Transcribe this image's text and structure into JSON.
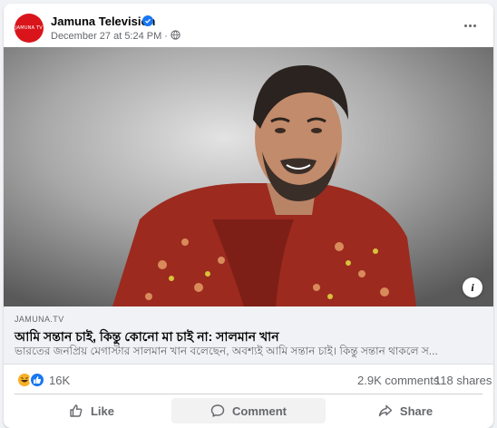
{
  "post": {
    "page_name": "Jamuna Television",
    "avatar_text": "JAMUNA TV",
    "timestamp": "December 27 at 5:24 PM",
    "separator": "·",
    "privacy_icon": "globe-icon",
    "more_icon": "more-options-icon",
    "verified_icon": "verified-badge-icon"
  },
  "link": {
    "domain": "JAMUNA.TV",
    "headline": "আমি সন্তান চাই, কিন্তু কোনো মা চাই না: সালমান খান",
    "description": "ভারতের জনপ্রিয় মেগাস্টার সালমান খান বলেছেন, অবশ্যই আমি সন্তান চাই। কিন্তু সন্তান থাকলে স..."
  },
  "stats": {
    "reactions": "16K",
    "comments": "2.9K comments",
    "shares": "118 shares",
    "reaction_icons": [
      "haha-icon",
      "like-icon"
    ]
  },
  "actions": {
    "like": "Like",
    "comment": "Comment",
    "share": "Share"
  },
  "colors": {
    "brand_blue": "#1877f2",
    "avatar_red": "#d9151b",
    "muted_text": "#65676b",
    "link_bg": "#f0f2f5"
  }
}
